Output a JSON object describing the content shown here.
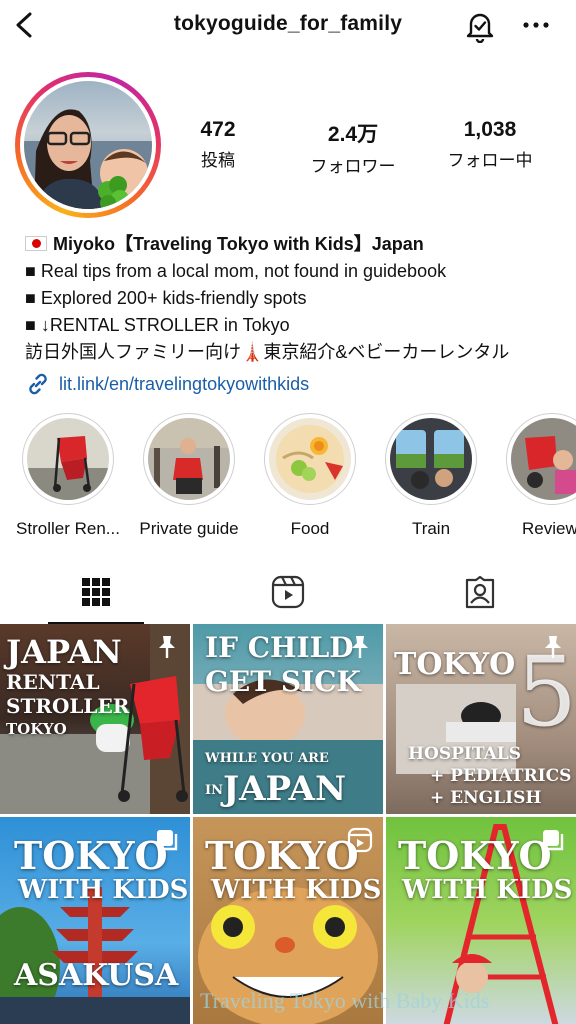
{
  "header": {
    "username": "tokyoguide_for_family",
    "back_icon": "chevron-left-icon",
    "notification_icon": "bell-check-icon",
    "more_icon": "more-horizontal-icon"
  },
  "stats": [
    {
      "value": "472",
      "label": "投稿"
    },
    {
      "value": "2.4万",
      "label": "フォロワー"
    },
    {
      "value": "1,038",
      "label": "フォロー中"
    }
  ],
  "bio": {
    "name": "Miyoko【Traveling Tokyo with Kids】Japan",
    "lines": [
      "■ Real tips from a local mom, not found in guidebook",
      "■ Explored 200+ kids-friendly spots",
      "■ ↓RENTAL STROLLER in Tokyo",
      "訪日外国人ファミリー向け🗼東京紹介&ベビーカーレンタル"
    ],
    "link": "lit.link/en/travelingtokyowithkids"
  },
  "highlights": [
    {
      "label": "Stroller Ren..."
    },
    {
      "label": "Private guide"
    },
    {
      "label": "Food"
    },
    {
      "label": "Train"
    },
    {
      "label": "Review"
    }
  ],
  "tabs": [
    {
      "icon": "grid-icon",
      "active": true
    },
    {
      "icon": "reels-icon",
      "active": false
    },
    {
      "icon": "tagged-icon",
      "active": false
    }
  ],
  "posts": [
    {
      "lines": [
        "JAPAN",
        "RENTAL",
        "STROLLER",
        "TOKYO"
      ],
      "badge": "pin-icon"
    },
    {
      "lines": [
        "IF CHILD",
        "GET SICK",
        "WHILE YOU ARE",
        "IN",
        "JAPAN"
      ],
      "badge": "pin-icon"
    },
    {
      "lines": [
        "TOKYO",
        "5",
        "HOSPITALS",
        "+ PEDIATRICS",
        "+ ENGLISH"
      ],
      "badge": "pin-icon"
    },
    {
      "lines": [
        "TOKYO",
        "WITH KIDS",
        "ASAKUSA"
      ],
      "badge": "carousel-icon"
    },
    {
      "lines": [
        "TOKYO",
        "WITH KIDS"
      ],
      "badge": "reels-icon"
    },
    {
      "lines": [
        "TOKYO",
        "WITH KIDS"
      ],
      "badge": "carousel-icon"
    }
  ],
  "watermark": "Traveling Tokyo with Baby Kids"
}
